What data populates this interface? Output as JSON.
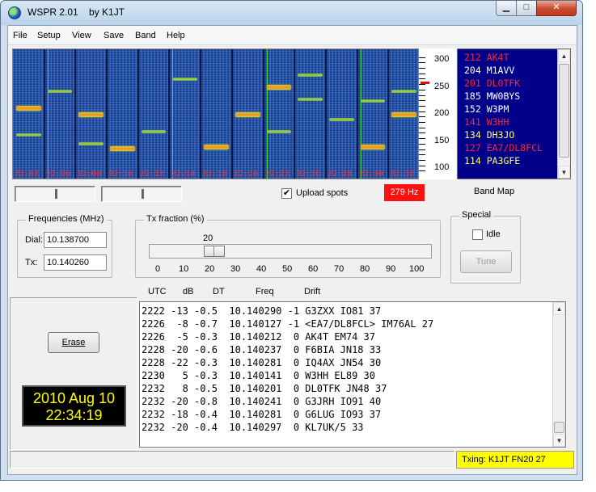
{
  "window": {
    "title": "WSPR 2.01    by K1JT",
    "minimize": "▁",
    "maximize": "□",
    "close": "✕",
    "app_icon": "globe-icon"
  },
  "menu": [
    "File",
    "Setup",
    "View",
    "Save",
    "Band",
    "Help"
  ],
  "waterfall": {
    "time_labels": [
      "22:02",
      "22:06",
      "22:08",
      "22:10",
      "22:12",
      "22:14",
      "22:18",
      "22:20",
      "22:22",
      "22:26",
      "22:28",
      "22:30",
      "22:32"
    ]
  },
  "freq_scale": {
    "labels": [
      "300",
      "250",
      "200",
      "150",
      "100"
    ],
    "marker_value": 258
  },
  "band_map": {
    "rows": [
      {
        "text": "212 AK4T",
        "color": "#ff2828"
      },
      {
        "text": "204 M1AVV",
        "color": "#ffffff"
      },
      {
        "text": "201 DL0TFK",
        "color": "#ff2828"
      },
      {
        "text": "185 MW0BYS",
        "color": "#ffffff"
      },
      {
        "text": "152 W3PM",
        "color": "#ffffff"
      },
      {
        "text": "141 W3HH",
        "color": "#ff2828"
      },
      {
        "text": "134 DH3JO",
        "color": "#ffff66"
      },
      {
        "text": "127 EA7/DL8FCL",
        "color": "#ff2828"
      },
      {
        "text": "114 PA3GFE",
        "color": "#ffff66"
      }
    ],
    "scroll_up": "▲",
    "scroll_down": "▼"
  },
  "upload": {
    "label": "Upload spots",
    "checked": "✔"
  },
  "df_readout": "279 Hz",
  "band_map_label": "Band Map",
  "frequencies": {
    "title": "Frequencies (MHz)",
    "dial_label": "Dial:",
    "dial_value": "10.138700",
    "tx_label": "Tx:",
    "tx_value": "10.140260"
  },
  "tx_fraction": {
    "title": "Tx fraction (%)",
    "current": "20",
    "ticks": [
      "0",
      "10",
      "20",
      "30",
      "40",
      "50",
      "60",
      "70",
      "80",
      "90",
      "100"
    ]
  },
  "special": {
    "title": "Special",
    "idle_label": "Idle",
    "tune_label": "Tune"
  },
  "columns": [
    "UTC",
    "dB",
    "DT",
    "Freq",
    "Drift"
  ],
  "decoded": [
    "2222 -13 -0.5  10.140290 -1 G3ZXX IO81 37",
    "2226  -8 -0.7  10.140127 -1 <EA7/DL8FCL> IM76AL 27",
    "2226  -5 -0.3  10.140212  0 AK4T EM74 37",
    "2228 -20 -0.6  10.140237  0 F6BIA JN18 33",
    "2228 -22 -0.3  10.140281  0 IQ4AX JN54 30",
    "2230   5 -0.3  10.140141  0 W3HH EL89 30",
    "2232   8 -0.5  10.140201  0 DL0TFK JN48 37",
    "2232 -20 -0.8  10.140241  0 G3JRH IO91 40",
    "2232 -18 -0.4  10.140281  0 G6LUG IO93 37",
    "2232 -20 -0.4  10.140297  0 KL7UK/5 33"
  ],
  "erase_label": "Erase",
  "clock": {
    "date": "2010 Aug 10",
    "time": "22:34:19"
  },
  "status": {
    "txing": "Txing: K1JT FN20 27"
  }
}
